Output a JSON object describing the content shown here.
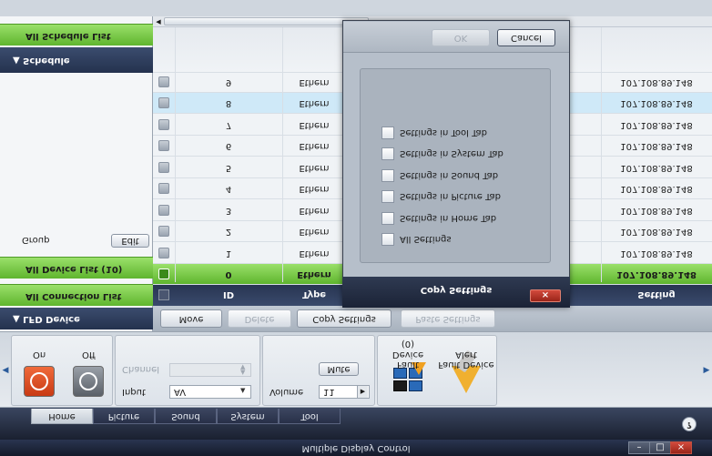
{
  "app": {
    "title": "Multiple Display Control",
    "window_buttons": [
      "–",
      "□",
      "×"
    ],
    "help_label": "?"
  },
  "tabs": [
    {
      "label": "Home",
      "active": true
    },
    {
      "label": "Picture",
      "active": false
    },
    {
      "label": "Sound",
      "active": false
    },
    {
      "label": "System",
      "active": false
    },
    {
      "label": "Tool",
      "active": false
    }
  ],
  "power": {
    "on_label": "On",
    "off_label": "Off"
  },
  "input": {
    "channel_label": "Channel",
    "input_label": "Input",
    "input_value": "AV"
  },
  "volume": {
    "label": "Volume",
    "value": "11",
    "mute_label": "Mute"
  },
  "faults": {
    "fault_device_label": "Fault Device",
    "fault_device_count": "(0)",
    "alert_label": "Fault Device Alert"
  },
  "left_panel": {
    "lfd_device": "LFD Device",
    "all_connection_list": "All Connection List",
    "all_device_list": "All Device List (10)",
    "group_label": "Group",
    "edit_label": "Edit",
    "schedule": "Schedule",
    "all_schedule_list": "All Schedule List"
  },
  "action_bar": {
    "move": "Move",
    "delete": "Delete",
    "copy_settings": "Copy Settings",
    "paste_settings": "Paste Settings"
  },
  "table": {
    "columns": [
      "ID",
      "Type",
      "Setting"
    ],
    "rows": [
      {
        "id": "0",
        "type": "Ethern",
        "ip": "107.108.89.148",
        "state": "green"
      },
      {
        "id": "1",
        "type": "Ethern",
        "ip": "107.108.89.148",
        "state": "normal"
      },
      {
        "id": "2",
        "type": "Ethern",
        "ip": "107.108.89.148",
        "state": "normal"
      },
      {
        "id": "3",
        "type": "Ethern",
        "ip": "107.108.89.148",
        "state": "normal"
      },
      {
        "id": "4",
        "type": "Ethern",
        "ip": "107.108.89.148",
        "state": "normal"
      },
      {
        "id": "5",
        "type": "Ethern",
        "ip": "107.108.89.148",
        "state": "normal"
      },
      {
        "id": "6",
        "type": "Ethern",
        "ip": "107.108.89.148",
        "state": "normal"
      },
      {
        "id": "7",
        "type": "Ethern",
        "ip": "107.108.89.148",
        "state": "normal"
      },
      {
        "id": "8",
        "type": "Ethern",
        "ip": "107.108.89.148",
        "state": "selected"
      },
      {
        "id": "9",
        "type": "Ethern",
        "ip": "107.108.89.148",
        "state": "normal"
      }
    ]
  },
  "dialog": {
    "title": "Copy Settings",
    "close_label": "×",
    "options": [
      "All Settings",
      "Settings in Home Tab",
      "Settings in Picture Tab",
      "Settings in Sound Tab",
      "Settings in System Tab",
      "Settings in Tool Tab"
    ],
    "ok_label": "OK",
    "cancel_label": "Cancel"
  }
}
